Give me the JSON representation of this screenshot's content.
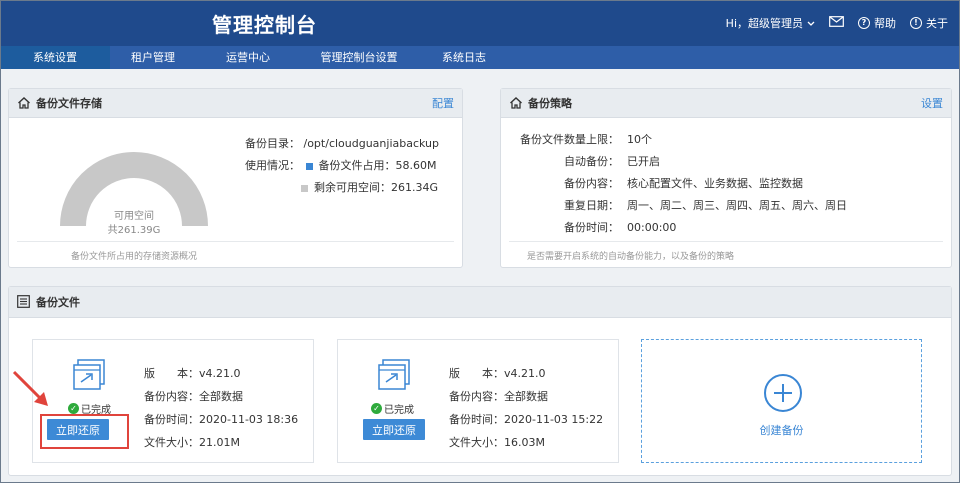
{
  "header": {
    "brand": "管理控制台",
    "greeting": "Hi，超级管理员",
    "help_label": "帮助",
    "about_label": "关于"
  },
  "nav": {
    "items": [
      {
        "label": "系统设置",
        "active": true
      },
      {
        "label": "租户管理",
        "active": false
      },
      {
        "label": "运营中心",
        "active": false
      },
      {
        "label": "管理控制台设置",
        "active": false
      },
      {
        "label": "系统日志",
        "active": false
      }
    ]
  },
  "storage": {
    "title": "备份文件存储",
    "config_link": "配置",
    "gauge_label": "可用空间",
    "gauge_total": "共261.39G",
    "dir_label": "备份目录：",
    "dir_value": "/opt/cloudguanjiabackup",
    "usage_label": "使用情况：",
    "used_label": "备份文件占用：",
    "used_value": "58.60M",
    "free_label": "剩余可用空间：",
    "free_value": "261.34G",
    "used_fraction": 0.0002,
    "used_color": "#3a86d4",
    "free_color": "#c8c8c8",
    "note": "备份文件所占用的存储资源概况"
  },
  "policy": {
    "title": "备份策略",
    "settings_link": "设置",
    "rows": [
      {
        "label": "备份文件数量上限：",
        "value": "10个"
      },
      {
        "label": "自动备份：",
        "value": "已开启"
      },
      {
        "label": "备份内容：",
        "value": "核心配置文件、业务数据、监控数据"
      },
      {
        "label": "重复日期：",
        "value": "周一、周二、周三、周四、周五、周六、周日"
      },
      {
        "label": "备份时间：",
        "value": "00:00:00"
      }
    ],
    "note": "是否需要开启系统的自动备份能力，以及备份的策略"
  },
  "backups": {
    "title": "备份文件",
    "items": [
      {
        "status": "已完成",
        "restore_label": "立即还原",
        "version_label": "版　　本：",
        "version": "v4.21.0",
        "content_label": "备份内容：",
        "content": "全部数据",
        "time_label": "备份时间：",
        "time": "2020-11-03 18:36",
        "size_label": "文件大小：",
        "size": "21.01M"
      },
      {
        "status": "已完成",
        "restore_label": "立即还原",
        "version_label": "版　　本：",
        "version": "v4.21.0",
        "content_label": "备份内容：",
        "content": "全部数据",
        "time_label": "备份时间：",
        "time": "2020-11-03 15:22",
        "size_label": "文件大小：",
        "size": "16.03M"
      }
    ],
    "create_label": "创建备份"
  },
  "colors": {
    "header_bg": "#1f4a8c",
    "nav_bg": "#2e5ea8",
    "accent": "#3a86d4",
    "highlight": "#e0443c"
  }
}
